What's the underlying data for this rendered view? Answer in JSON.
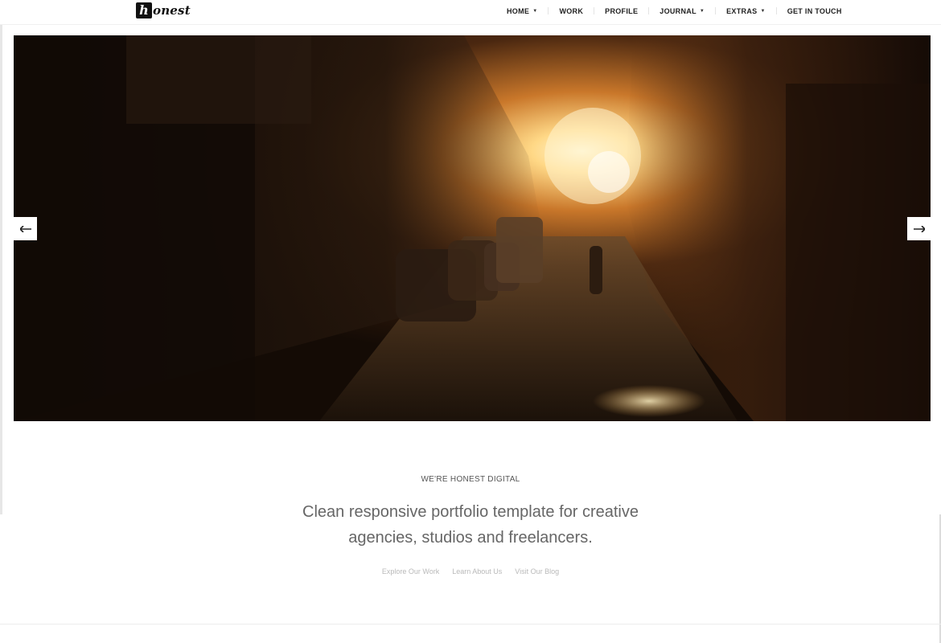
{
  "logo": {
    "mark": "h",
    "rest": "onest"
  },
  "nav": {
    "items": [
      {
        "label": "HOME",
        "has_caret": true
      },
      {
        "label": "WORK",
        "has_caret": false
      },
      {
        "label": "PROFILE",
        "has_caret": false
      },
      {
        "label": "JOURNAL",
        "has_caret": true
      },
      {
        "label": "EXTRAS",
        "has_caret": true
      },
      {
        "label": "GET IN TOUCH",
        "has_caret": false
      }
    ]
  },
  "hero": {
    "icons": {
      "prev": "arrow-left-icon",
      "next": "arrow-right-icon"
    }
  },
  "intro": {
    "kicker": "WE'RE HONEST DIGITAL",
    "headline": "Clean responsive portfolio template for creative agencies, studios and freelancers.",
    "links": [
      {
        "label": "Explore Our Work"
      },
      {
        "label": "Learn About Us"
      },
      {
        "label": "Visit Our Blog"
      }
    ]
  },
  "colors": {
    "text_dark": "#222222",
    "text_muted": "#666666",
    "link_muted": "#b9b9b9",
    "hero_glow": "#ffd27a"
  }
}
